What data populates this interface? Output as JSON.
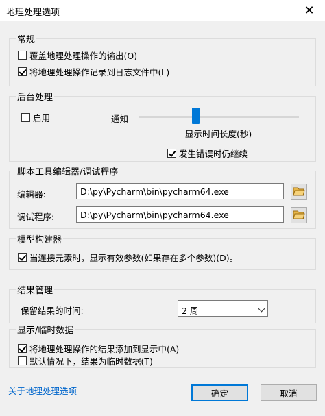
{
  "window": {
    "title": "地理处理选项",
    "close_glyph": "✕"
  },
  "general": {
    "title": "常规",
    "overwrite_outputs": {
      "label": "覆盖地理处理操作的输出(O)",
      "checked": false
    },
    "log_to_history": {
      "label": "将地理处理操作记录到日志文件中(L)",
      "checked": true
    }
  },
  "background": {
    "title": "后台处理",
    "enable": {
      "label": "启用",
      "checked": false
    },
    "notify_label": "通知",
    "notify_level": 0.35,
    "duration_label": "显示时间长度(秒)",
    "continue_on_error": {
      "label": "发生错误时仍继续",
      "checked": true
    }
  },
  "script_editor": {
    "title": "脚本工具编辑器/调试程序",
    "editor_label": "编辑器:",
    "editor_value": "D:\\py\\Pycharm\\bin\\pycharm64.exe",
    "debugger_label": "调试程序:",
    "debugger_value": "D:\\py\\Pycharm\\bin\\pycharm64.exe"
  },
  "model_builder": {
    "title": "模型构建器",
    "valid_params": {
      "label": "当连接元素时，显示有效参数(如果存在多个参数)(D)。",
      "checked": true
    }
  },
  "results": {
    "title": "结果管理",
    "keep_label": "保留结果的时间:",
    "keep_value": "2 周"
  },
  "display": {
    "title": "显示/临时数据",
    "add_to_display": {
      "label": "将地理处理操作的结果添加到显示中(A)",
      "checked": true
    },
    "temp_default": {
      "label": "默认情况下，结果为临时数据(T)",
      "checked": false
    }
  },
  "footer": {
    "about_link": "关于地理处理选项",
    "ok_label": "确定",
    "cancel_label": "取消"
  }
}
